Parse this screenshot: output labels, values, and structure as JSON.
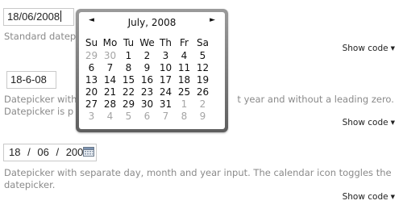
{
  "input1": {
    "value": "18/06/2008"
  },
  "desc1": "Standard datepicker",
  "showcode": "Show code",
  "input2": {
    "value": "18-6-08"
  },
  "desc2_line1": "Datepicker with",
  "desc2_line1_end": "t year and without a leading zero.",
  "desc2_line2": "Datepicker is p",
  "input3": {
    "day": "18",
    "month": "06",
    "year": "2008",
    "sep": "/"
  },
  "desc3": "Datepicker with separate day, month and year input. The calendar icon toggles the datepicker.",
  "calendar": {
    "title": "July, 2008",
    "prev": "◄",
    "next": "►",
    "weekdays": [
      "Su",
      "Mo",
      "Tu",
      "We",
      "Th",
      "Fr",
      "Sa"
    ],
    "weeks": [
      [
        {
          "d": "29",
          "m": true
        },
        {
          "d": "30",
          "m": true
        },
        {
          "d": "1"
        },
        {
          "d": "2"
        },
        {
          "d": "3"
        },
        {
          "d": "4"
        },
        {
          "d": "5"
        }
      ],
      [
        {
          "d": "6"
        },
        {
          "d": "7"
        },
        {
          "d": "8"
        },
        {
          "d": "9"
        },
        {
          "d": "10"
        },
        {
          "d": "11"
        },
        {
          "d": "12"
        }
      ],
      [
        {
          "d": "13"
        },
        {
          "d": "14"
        },
        {
          "d": "15"
        },
        {
          "d": "16"
        },
        {
          "d": "17"
        },
        {
          "d": "18"
        },
        {
          "d": "19"
        }
      ],
      [
        {
          "d": "20"
        },
        {
          "d": "21"
        },
        {
          "d": "22"
        },
        {
          "d": "23"
        },
        {
          "d": "24"
        },
        {
          "d": "25"
        },
        {
          "d": "26"
        }
      ],
      [
        {
          "d": "27"
        },
        {
          "d": "28"
        },
        {
          "d": "29"
        },
        {
          "d": "30"
        },
        {
          "d": "31"
        },
        {
          "d": "1",
          "m": true
        },
        {
          "d": "2",
          "m": true
        }
      ],
      [
        {
          "d": "3",
          "m": true
        },
        {
          "d": "4",
          "m": true
        },
        {
          "d": "5",
          "m": true
        },
        {
          "d": "6",
          "m": true
        },
        {
          "d": "7",
          "m": true
        },
        {
          "d": "8",
          "m": true
        },
        {
          "d": "9",
          "m": true
        }
      ]
    ]
  },
  "icons": {
    "calendar": "calendar-icon",
    "dropdown": "chevron-down-icon"
  }
}
